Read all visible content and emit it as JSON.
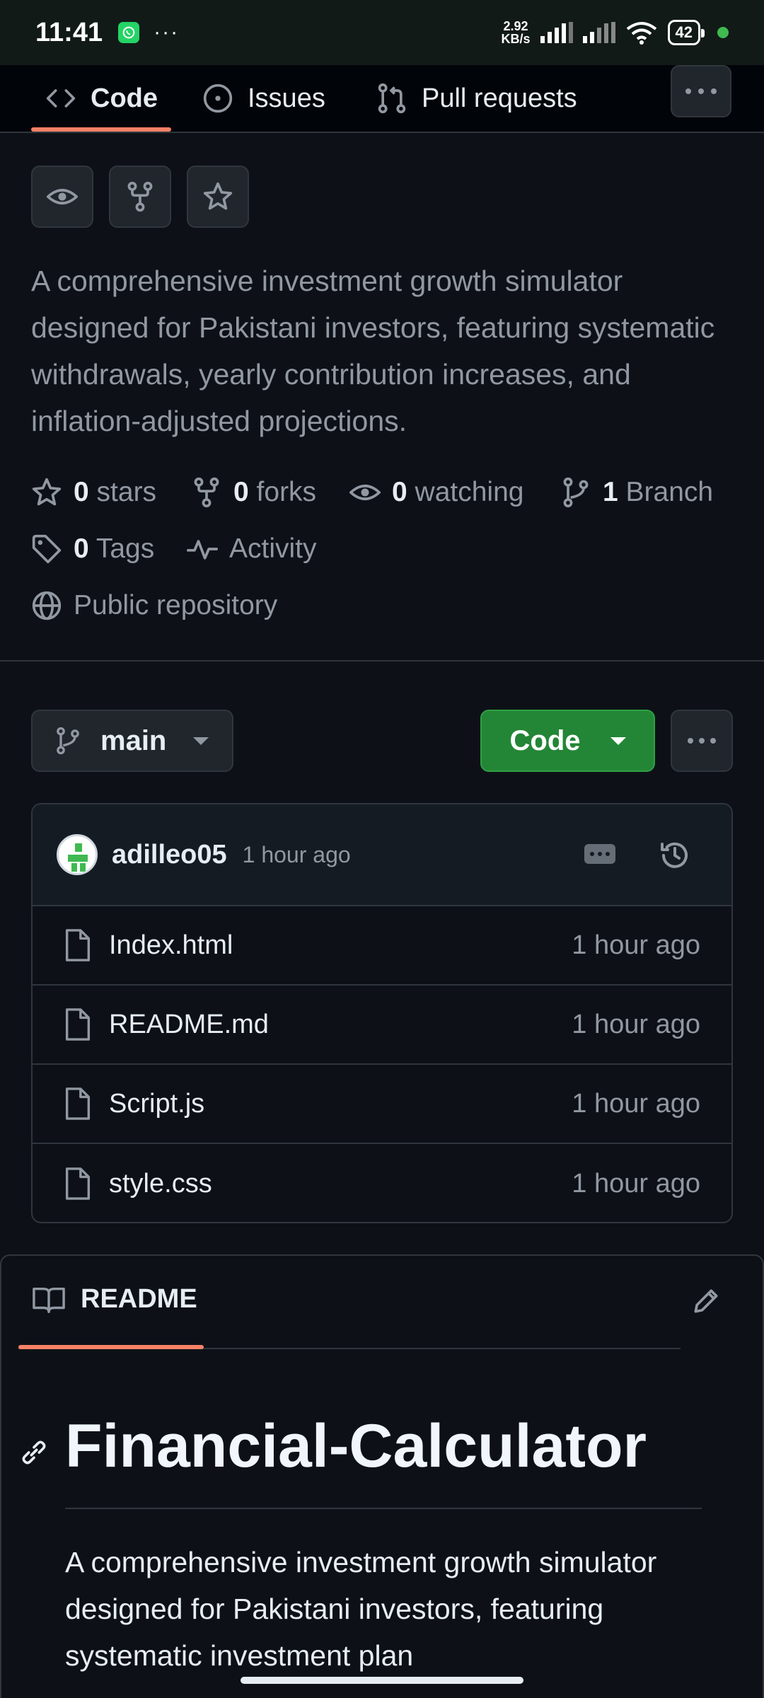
{
  "status_bar": {
    "time": "11:41",
    "dots": "···",
    "speed_value": "2.92",
    "speed_unit": "KB/s",
    "battery": "42"
  },
  "repo_tabs": [
    {
      "label": "Code",
      "icon": "code-icon",
      "active": true
    },
    {
      "label": "Issues",
      "icon": "issue-icon",
      "active": false
    },
    {
      "label": "Pull requests",
      "icon": "pull-request-icon",
      "active": false
    }
  ],
  "description": "A comprehensive investment growth simulator designed for Pakistani investors, featuring systematic withdrawals, yearly contribution increases, and inflation-adjusted projections.",
  "stats": {
    "stars": {
      "count": "0",
      "label": "stars"
    },
    "forks": {
      "count": "0",
      "label": "forks"
    },
    "watching": {
      "count": "0",
      "label": "watching"
    },
    "branches": {
      "count": "1",
      "label": "Branch"
    },
    "tags": {
      "count": "0",
      "label": "Tags"
    },
    "activity": "Activity",
    "visibility": "Public repository"
  },
  "branch": {
    "name": "main"
  },
  "code_button": "Code",
  "latest_commit": {
    "user": "adilleo05",
    "time": "1 hour ago"
  },
  "files": [
    {
      "name": "Index.html",
      "time": "1 hour ago"
    },
    {
      "name": "README.md",
      "time": "1 hour ago"
    },
    {
      "name": "Script.js",
      "time": "1 hour ago"
    },
    {
      "name": "style.css",
      "time": "1 hour ago"
    }
  ],
  "readme": {
    "tab_label": "README",
    "title": "Financial-Calculator",
    "body": "A comprehensive investment growth simulator designed for Pakistani investors, featuring systematic investment plan"
  },
  "colors": {
    "accent_underline": "#f78166",
    "primary_button": "#238636",
    "background": "#0d1117"
  }
}
